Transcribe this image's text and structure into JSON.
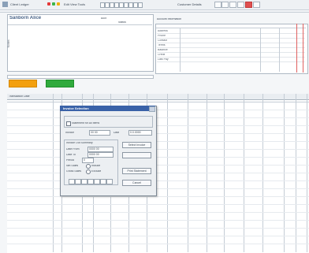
{
  "window": {
    "title": "Client Ledger",
    "menu_text": "Edit  View  Tools",
    "mode_label": "Customer Details"
  },
  "header": {
    "client_name": "Sanborn Alice",
    "meta_line1": "Acct",
    "meta_line2": "Status",
    "notes_label": "Notes"
  },
  "info_table": {
    "title": "Account Information",
    "rows": [
      "Address",
      "Phone",
      "Contact",
      "Terms",
      "Balance",
      "Credit",
      "Last Pay"
    ],
    "col_headers": [
      "",
      "",
      "",
      ""
    ]
  },
  "buttons": {
    "primary": "",
    "secondary": ""
  },
  "grid": {
    "first_col_label": "Transaction Date",
    "col_headers": [
      "",
      "",
      "",
      "",
      "",
      "",
      "",
      "",
      "",
      "",
      "",
      "",
      "",
      "",
      "",
      ""
    ]
  },
  "dialog": {
    "title": "Invoice Selection",
    "checkbox_label": "Statement for All Items",
    "invoice_label": "Invoice",
    "invoice_value": "00 00",
    "date_label": "Date",
    "date_value": "0.0.0000",
    "group_label": "Invoice Out Summary",
    "from_label": "Date From",
    "from_value": "0000 00",
    "to_label": "Date To",
    "to_value": "0000 00",
    "period_label": "Period",
    "period_value": "0",
    "sub_label1": "Net Sales",
    "sub_label2": "Gross Sales",
    "opt1": "Include",
    "opt2": "Exclude",
    "btn_select": "Select Invoice",
    "btn_blank": "",
    "btn_print": "Print Statement",
    "btn_cancel": "Cancel"
  }
}
